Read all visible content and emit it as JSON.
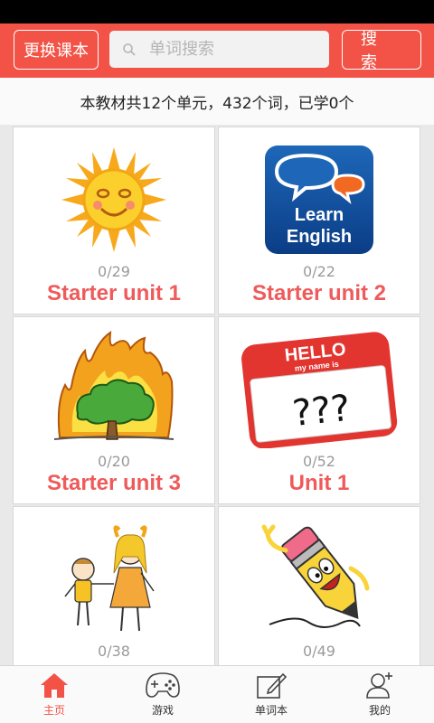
{
  "header": {
    "change_book_label": "更换课本",
    "search_placeholder": "单词搜索",
    "search_value": "",
    "search_button_label": "搜索"
  },
  "summary": "本教材共12个单元，432个词，已学0个",
  "units": [
    {
      "progress": "0/29",
      "title": "Starter unit 1",
      "image": "sun-icon"
    },
    {
      "progress": "0/22",
      "title": "Starter unit 2",
      "image": "learn-english-icon"
    },
    {
      "progress": "0/20",
      "title": "Starter unit 3",
      "image": "burning-tree-icon"
    },
    {
      "progress": "0/52",
      "title": "Unit 1",
      "image": "hello-name-tag-icon"
    },
    {
      "progress": "0/38",
      "title": "",
      "image": "children-icon"
    },
    {
      "progress": "0/49",
      "title": "",
      "image": "pencil-character-icon"
    }
  ],
  "learn_english_text": {
    "line1": "Learn",
    "line2": "English"
  },
  "name_tag_text": {
    "hello": "HELLO",
    "sub": "my name is",
    "marks": "???"
  },
  "nav": [
    {
      "label": "主页",
      "icon": "home-icon",
      "active": true
    },
    {
      "label": "游戏",
      "icon": "gamepad-icon",
      "active": false
    },
    {
      "label": "单词本",
      "icon": "notebook-icon",
      "active": false
    },
    {
      "label": "我的",
      "icon": "user-icon",
      "active": false
    }
  ],
  "colors": {
    "accent": "#f25346",
    "title_red": "#ef5a5a"
  }
}
